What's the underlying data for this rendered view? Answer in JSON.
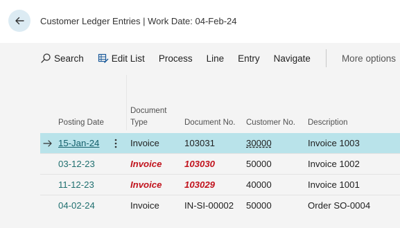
{
  "header": {
    "title": "Customer Ledger Entries | Work Date: 04-Feb-24"
  },
  "toolbar": {
    "search": "Search",
    "edit_list": "Edit List",
    "process": "Process",
    "line": "Line",
    "entry": "Entry",
    "navigate": "Navigate",
    "more_options": "More options"
  },
  "columns": {
    "posting_date": "Posting Date",
    "document_type_1": "Document",
    "document_type_2": "Type",
    "document_no": "Document No.",
    "customer_no": "Customer No.",
    "description": "Description"
  },
  "rows": [
    {
      "posting_date": "15-Jan-24",
      "document_type": "Invoice",
      "document_no": "103031",
      "customer_no": "30000",
      "description": "Invoice 1003",
      "selected": true,
      "flagged": false
    },
    {
      "posting_date": "03-12-23",
      "document_type": "Invoice",
      "document_no": "103030",
      "customer_no": "50000",
      "description": "Invoice 1002",
      "selected": false,
      "flagged": true
    },
    {
      "posting_date": "11-12-23",
      "document_type": "Invoice",
      "document_no": "103029",
      "customer_no": "40000",
      "description": "Invoice 1001",
      "selected": false,
      "flagged": true
    },
    {
      "posting_date": "04-02-24",
      "document_type": "Invoice",
      "document_no": "IN-SI-00002",
      "customer_no": "50000",
      "description": "Order SO-0004",
      "selected": false,
      "flagged": false
    }
  ],
  "colors": {
    "accent": "#1f6f6f",
    "selected_row": "#b9e3ea",
    "warning": "#c1121c"
  },
  "icons": [
    "back-arrow-icon",
    "search-icon",
    "edit-list-icon",
    "row-arrow-icon",
    "row-menu-icon"
  ]
}
